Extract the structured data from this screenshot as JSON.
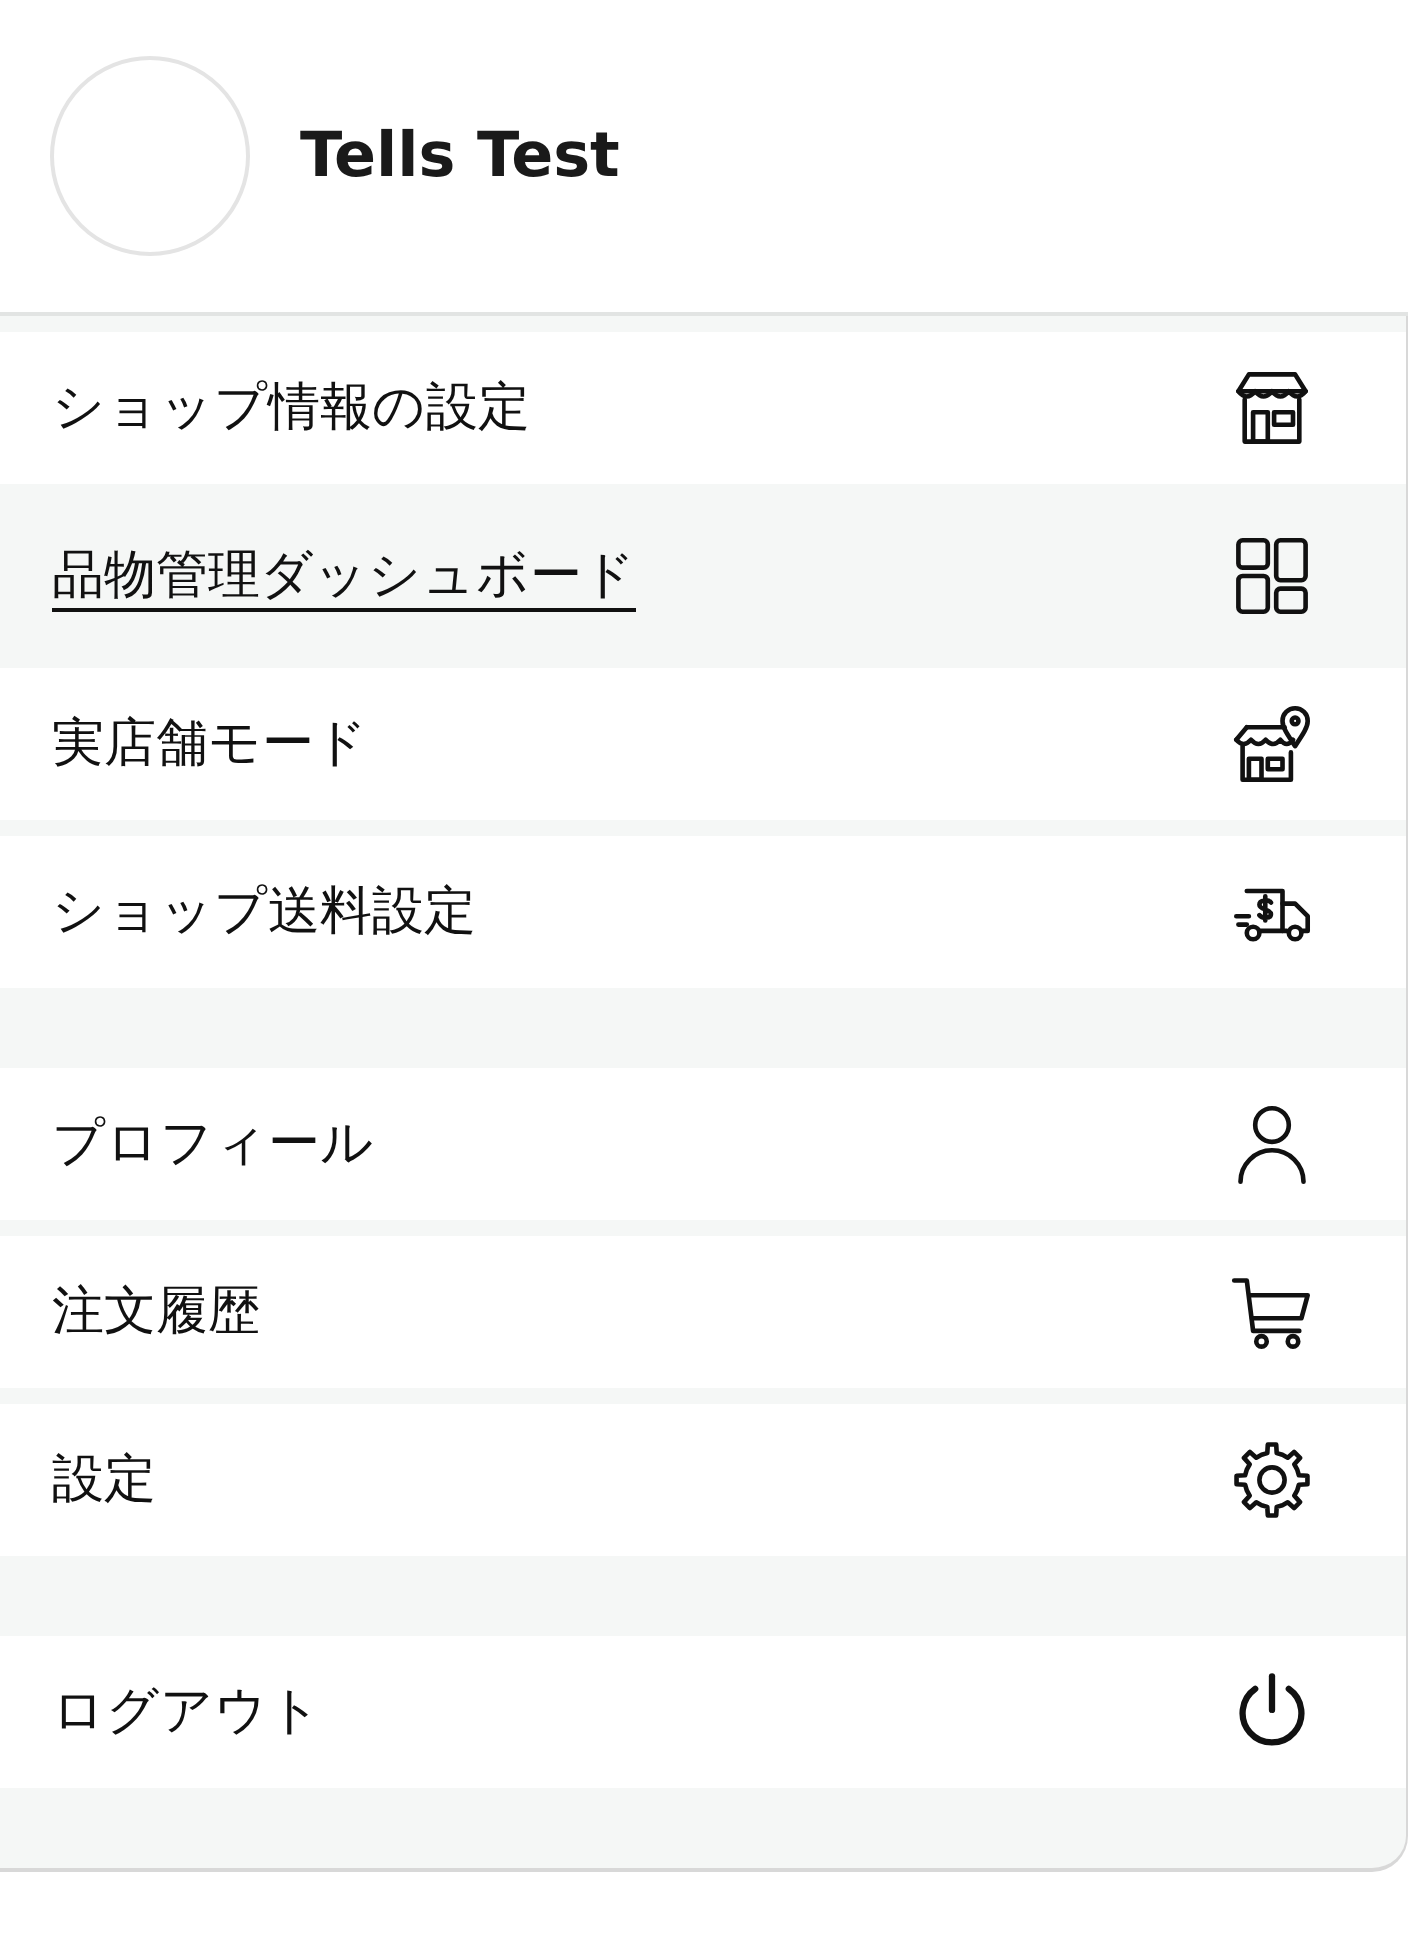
{
  "profile": {
    "name": "Tells Test"
  },
  "menu_groups": [
    {
      "items": [
        {
          "label": "ショップ情報の設定",
          "selected": false
        },
        {
          "label": "品物管理ダッシュボード",
          "selected": true
        },
        {
          "label": "実店舗モード",
          "selected": false
        },
        {
          "label": "ショップ送料設定",
          "selected": false
        }
      ]
    },
    {
      "items": [
        {
          "label": "プロフィール",
          "selected": false
        },
        {
          "label": "注文履歴",
          "selected": false
        },
        {
          "label": "設定",
          "selected": false
        }
      ]
    },
    {
      "items": [
        {
          "label": "ログアウト",
          "selected": false
        }
      ]
    }
  ]
}
